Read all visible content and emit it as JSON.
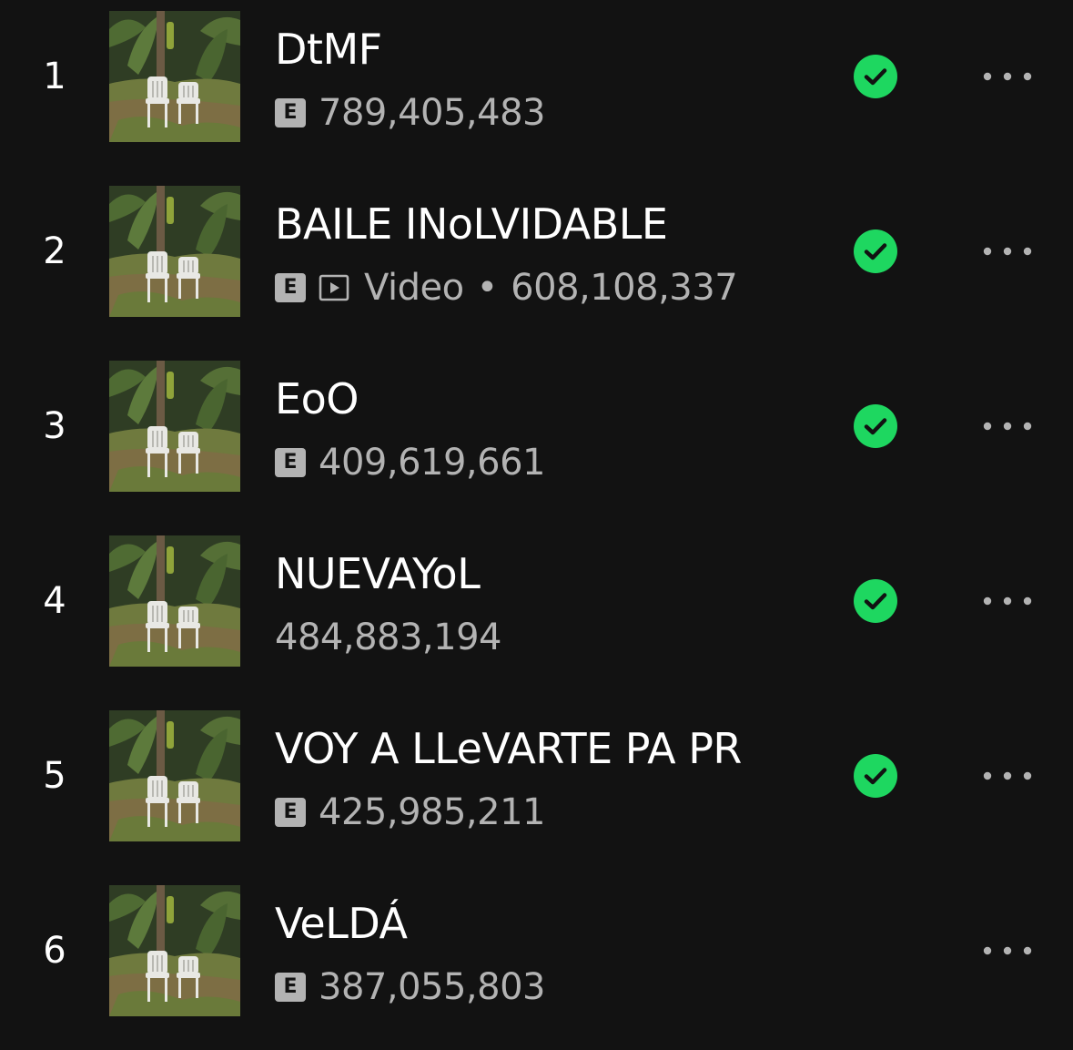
{
  "colors": {
    "background": "#121212",
    "accent": "#1ed760",
    "secondary_text": "#b3b3b3",
    "primary_text": "#ffffff"
  },
  "tracks": [
    {
      "rank": "1",
      "title": "DtMF",
      "explicit": "E",
      "video_label": "",
      "separator": "",
      "streams": "789,405,483",
      "saved": true
    },
    {
      "rank": "2",
      "title": "BAILE INoLVIDABLE",
      "explicit": "E",
      "video_label": "Video",
      "separator": "•",
      "streams": "608,108,337",
      "saved": true
    },
    {
      "rank": "3",
      "title": "EoO",
      "explicit": "E",
      "video_label": "",
      "separator": "",
      "streams": "409,619,661",
      "saved": true
    },
    {
      "rank": "4",
      "title": "NUEVAYoL",
      "explicit": "",
      "video_label": "",
      "separator": "",
      "streams": "484,883,194",
      "saved": true
    },
    {
      "rank": "5",
      "title": "VOY A LLeVARTE PA PR",
      "explicit": "E",
      "video_label": "",
      "separator": "",
      "streams": "425,985,211",
      "saved": true
    },
    {
      "rank": "6",
      "title": "VeLDÁ",
      "explicit": "E",
      "video_label": "",
      "separator": "",
      "streams": "387,055,803",
      "saved": false
    }
  ],
  "icons": {
    "explicit": "explicit-badge",
    "video": "video-icon",
    "saved": "check-circle-icon",
    "more": "more-options-icon",
    "cover": "album-cover"
  }
}
